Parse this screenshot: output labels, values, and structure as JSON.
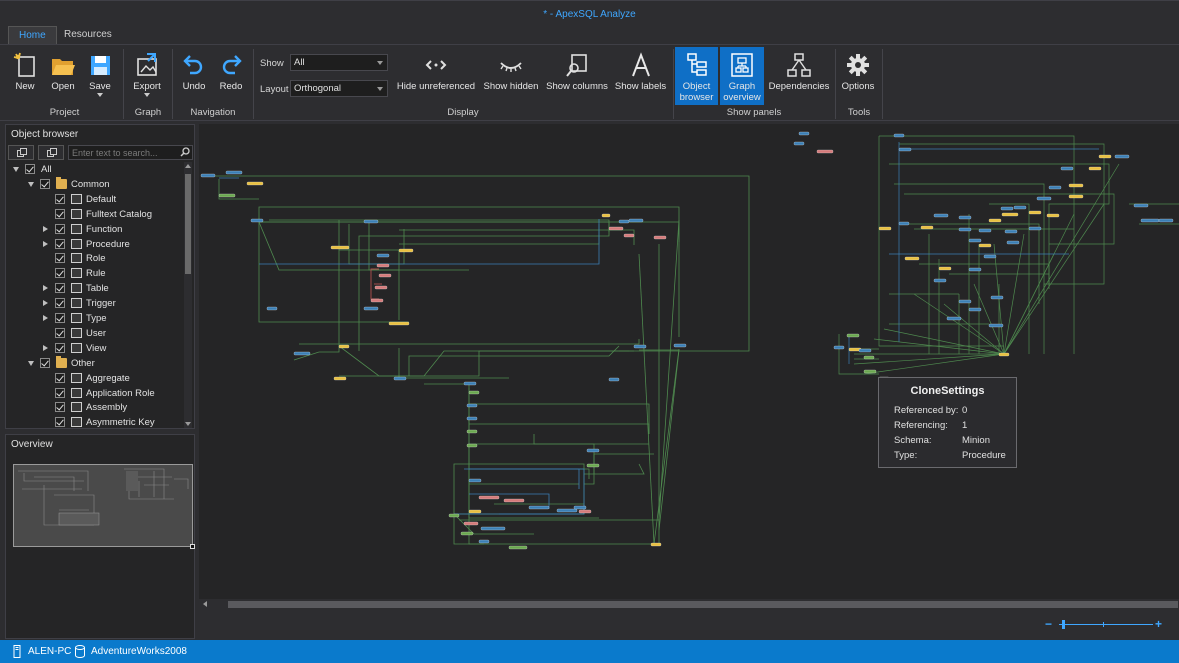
{
  "window": {
    "title": "* - ApexSQL Analyze"
  },
  "tabs": [
    {
      "label": "Home",
      "active": true
    },
    {
      "label": "Resources",
      "active": false
    }
  ],
  "ribbon": {
    "project": {
      "label": "Project",
      "new": "New",
      "open": "Open",
      "save": "Save"
    },
    "graph": {
      "label": "Graph",
      "export": "Export"
    },
    "navigation": {
      "label": "Navigation",
      "undo": "Undo",
      "redo": "Redo"
    },
    "display": {
      "label": "Display",
      "show_label": "Show",
      "show_value": "All",
      "layout_label": "Layout",
      "layout_value": "Orthogonal",
      "hide_unreferenced": "Hide unreferenced",
      "show_hidden": "Show hidden",
      "show_columns": "Show columns",
      "show_labels": "Show labels"
    },
    "show_panels": {
      "label": "Show panels",
      "object_browser_1": "Object",
      "object_browser_2": "browser",
      "graph_overview_1": "Graph",
      "graph_overview_2": "overview",
      "dependencies": "Dependencies"
    },
    "tools": {
      "label": "Tools",
      "options": "Options"
    }
  },
  "object_browser": {
    "title": "Object browser",
    "search_placeholder": "Enter text to search...",
    "items": [
      {
        "label": "All",
        "level": 0,
        "expander": "open",
        "icon": "none"
      },
      {
        "label": "Common",
        "level": 1,
        "expander": "open",
        "icon": "folder-icon"
      },
      {
        "label": "Default",
        "level": 2,
        "expander": "none",
        "icon": "default-icon"
      },
      {
        "label": "Fulltext Catalog",
        "level": 2,
        "expander": "none",
        "icon": "fulltext-catalog-icon"
      },
      {
        "label": "Function",
        "level": 2,
        "expander": "closed",
        "icon": "function-icon"
      },
      {
        "label": "Procedure",
        "level": 2,
        "expander": "closed",
        "icon": "procedure-icon"
      },
      {
        "label": "Role",
        "level": 2,
        "expander": "none",
        "icon": "role-icon"
      },
      {
        "label": "Rule",
        "level": 2,
        "expander": "none",
        "icon": "rule-icon"
      },
      {
        "label": "Table",
        "level": 2,
        "expander": "closed",
        "icon": "table-icon"
      },
      {
        "label": "Trigger",
        "level": 2,
        "expander": "closed",
        "icon": "trigger-icon"
      },
      {
        "label": "Type",
        "level": 2,
        "expander": "closed",
        "icon": "type-icon"
      },
      {
        "label": "User",
        "level": 2,
        "expander": "none",
        "icon": "user-icon"
      },
      {
        "label": "View",
        "level": 2,
        "expander": "closed",
        "icon": "view-icon"
      },
      {
        "label": "Other",
        "level": 1,
        "expander": "open",
        "icon": "folder-icon"
      },
      {
        "label": "Aggregate",
        "level": 2,
        "expander": "none",
        "icon": "aggregate-icon"
      },
      {
        "label": "Application Role",
        "level": 2,
        "expander": "none",
        "icon": "application-role-icon"
      },
      {
        "label": "Assembly",
        "level": 2,
        "expander": "none",
        "icon": "assembly-icon"
      },
      {
        "label": "Asymmetric Key",
        "level": 2,
        "expander": "none",
        "icon": "asymmetric-key-icon"
      }
    ]
  },
  "overview": {
    "title": "Overview"
  },
  "tooltip": {
    "title": "CloneSettings",
    "rows": [
      {
        "key": "Referenced by:",
        "value": "0"
      },
      {
        "key": "Referencing:",
        "value": "1"
      },
      {
        "key": "Schema:",
        "value": "Minion"
      },
      {
        "key": "Type:",
        "value": "Procedure"
      }
    ]
  },
  "statusbar": {
    "computer": "ALEN-PC",
    "database": "AdventureWorks2008"
  },
  "colors": {
    "accent": "#0f6fc6",
    "status_bar": "#0a7acc",
    "edge_green": "#4f8a4f",
    "edge_blue": "#3b7fb5",
    "node_yellow": "#e8c040"
  }
}
